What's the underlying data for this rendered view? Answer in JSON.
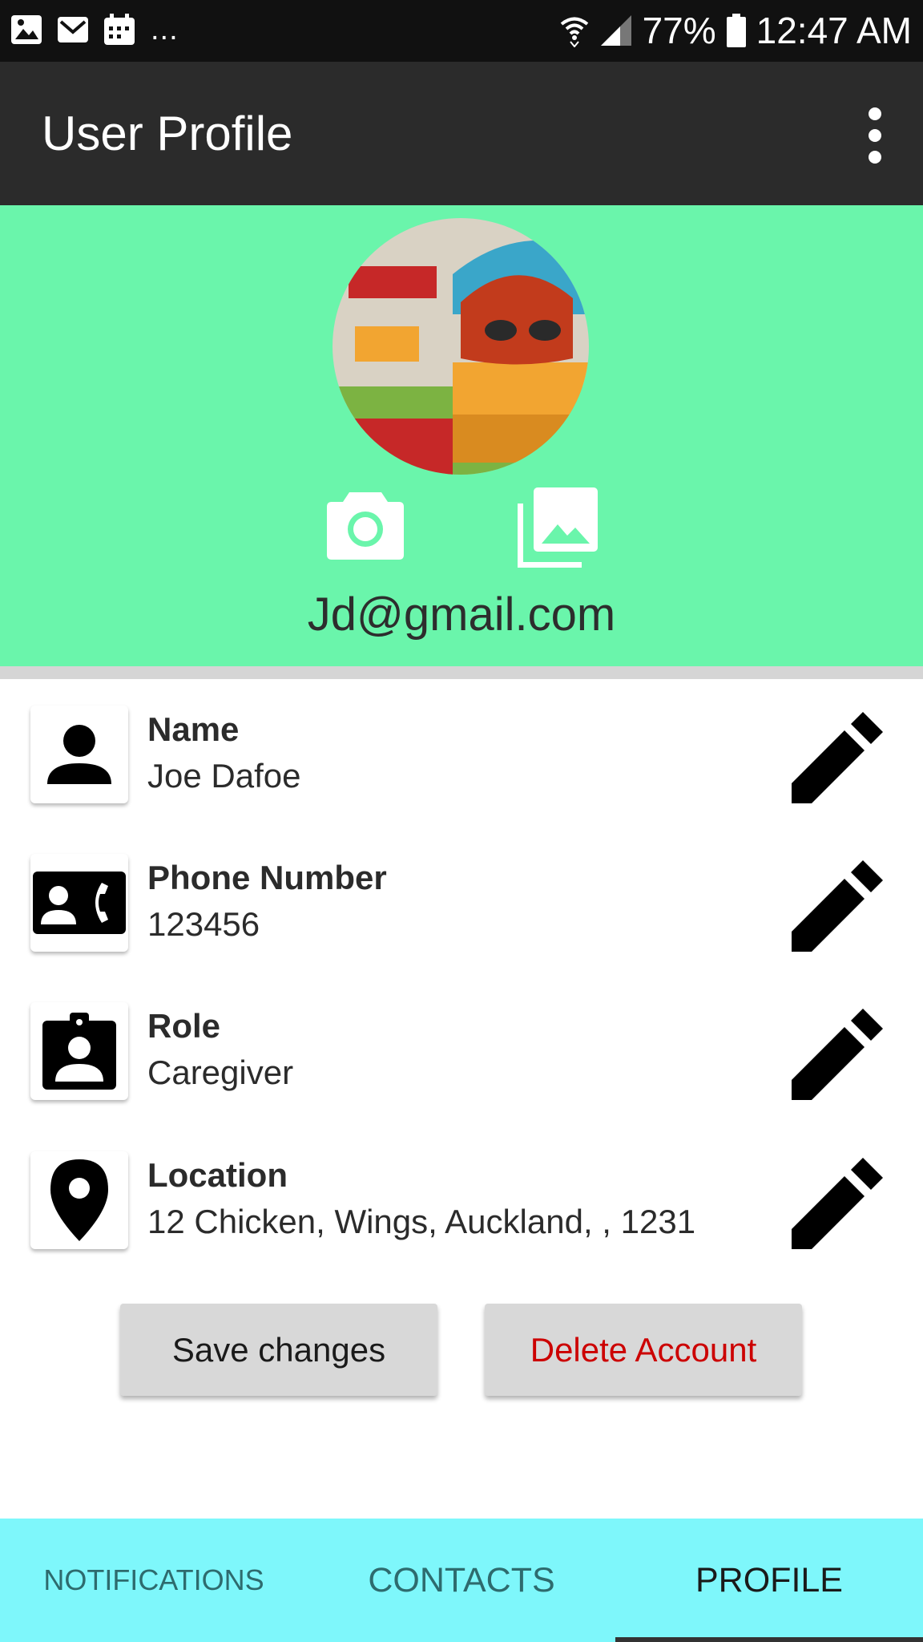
{
  "status_bar": {
    "more": "...",
    "battery": "77%",
    "time": "12:47 AM",
    "icons": [
      "image-icon",
      "mail-icon",
      "calendar-icon",
      "wifi-icon",
      "signal-icon",
      "battery-icon"
    ]
  },
  "app_bar": {
    "title": "User Profile",
    "overflow_icon": "more-vert-icon"
  },
  "profile": {
    "email": "Jd@gmail.com",
    "header_color": "#6af5ab",
    "camera_icon": "camera-icon",
    "gallery_icon": "gallery-icon"
  },
  "fields": [
    {
      "label": "Name",
      "value": "Joe Dafoe",
      "icon": "person-icon"
    },
    {
      "label": "Phone Number",
      "value": "123456",
      "icon": "contact-phone-icon"
    },
    {
      "label": "Role",
      "value": "Caregiver",
      "icon": "badge-icon"
    },
    {
      "label": "Location",
      "value": "12 Chicken, Wings, Auckland, , 1231",
      "icon": "location-pin-icon"
    }
  ],
  "actions": {
    "save_label": "Save changes",
    "delete_label": "Delete Account",
    "delete_color": "#cc0000"
  },
  "tabs": {
    "items": [
      {
        "label": "NOTIFICATIONS",
        "active": false
      },
      {
        "label": "CONTACTS",
        "active": false
      },
      {
        "label": "PROFILE",
        "active": true
      }
    ],
    "bar_color": "#7ef7fb"
  }
}
